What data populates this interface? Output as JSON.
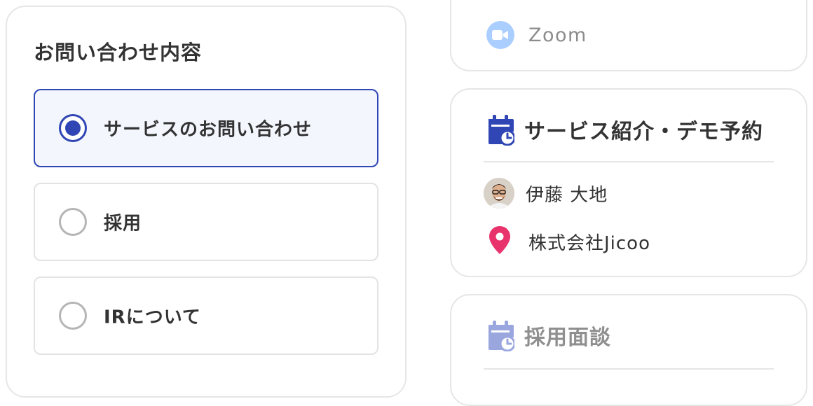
{
  "form": {
    "title": "お問い合わせ内容",
    "options": [
      {
        "label": "サービスのお問い合わせ",
        "selected": true
      },
      {
        "label": "採用",
        "selected": false
      },
      {
        "label": "IRについて",
        "selected": false
      }
    ]
  },
  "meeting_card": {
    "location_label": "Zoom",
    "location_icon": "video-camera-icon"
  },
  "service_card": {
    "title": "サービス紹介・デモ予約",
    "title_icon": "calendar-clock-icon",
    "host_name": "伊藤 大地",
    "company": "株式会社Jicoo",
    "company_icon": "map-pin-icon"
  },
  "recruit_card": {
    "title": "採用面談",
    "title_icon": "calendar-clock-icon"
  },
  "colors": {
    "accent": "#2f46b4",
    "selected_bg": "#f3f6fd",
    "pin": "#e8336d",
    "zoom": "#a9ceff"
  }
}
